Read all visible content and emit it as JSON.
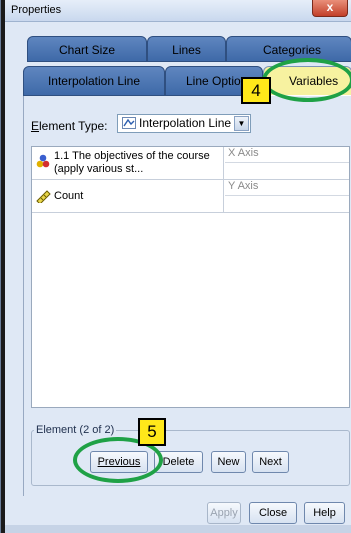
{
  "window": {
    "title": "Properties",
    "close_glyph": "x"
  },
  "tabs": {
    "row1": [
      "Chart Size",
      "Lines",
      "Categories"
    ],
    "row2": [
      "Interpolation Line",
      "Line Options",
      "Variables"
    ]
  },
  "element_type": {
    "label_hot": "E",
    "label_rest": "lement Type:",
    "value": "Interpolation Line"
  },
  "variables": [
    {
      "name": "1.1 The objectives of the course (apply various st...",
      "role": "X Axis",
      "icon": "nominal-icon"
    },
    {
      "name": "Count",
      "role": "Y Axis",
      "icon": "ruler-icon"
    }
  ],
  "element_group": {
    "label": "Element (2 of 2)"
  },
  "buttons": {
    "previous": "Previous",
    "delete": "Delete",
    "new": "New",
    "next": "Next",
    "apply": "Apply",
    "close": "Close",
    "help": "Help"
  },
  "annotations": {
    "badge4": "4",
    "badge5": "5"
  },
  "colors": {
    "tab_blue": "#4a74b3",
    "panel_bg": "#dfe8f5",
    "ring_green": "#1fa146",
    "badge_yellow": "#ffe81a"
  }
}
